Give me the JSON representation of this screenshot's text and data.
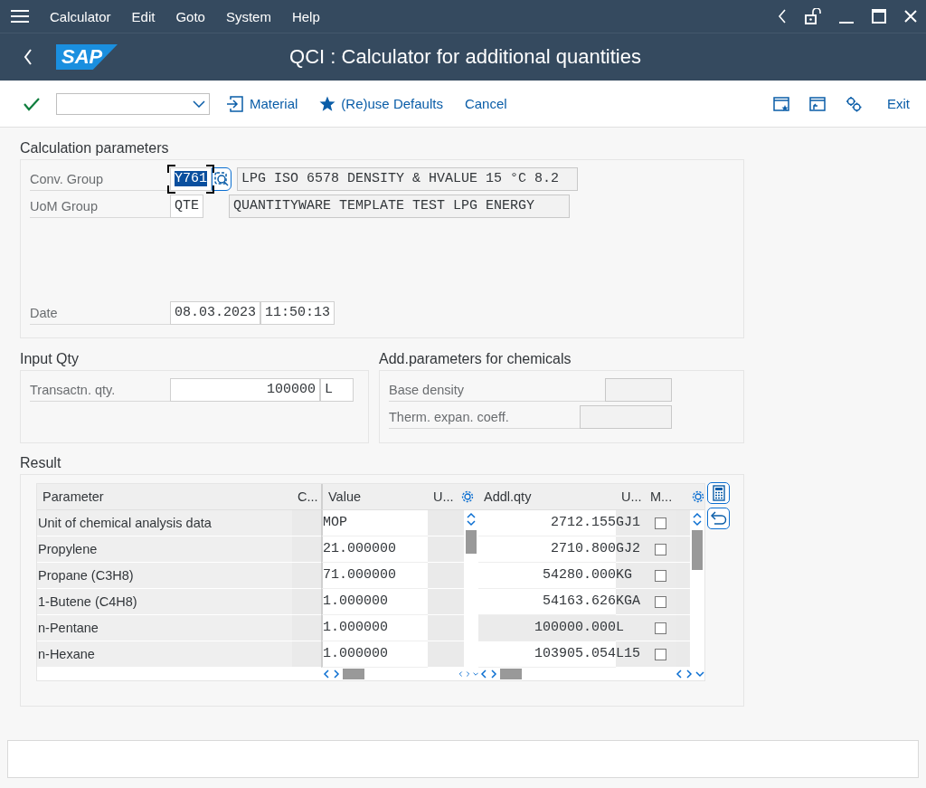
{
  "menu_bar": {
    "items": [
      "Calculator",
      "Edit",
      "Goto",
      "System",
      "Help"
    ]
  },
  "title_bar": {
    "logo": "SAP",
    "title": "QCI : Calculator for additional quantities"
  },
  "toolbar": {
    "buttons": [
      {
        "label": "Material",
        "kind": "import"
      },
      {
        "label": "(Re)use Defaults",
        "kind": "star"
      },
      {
        "label": "Cancel",
        "kind": "plain"
      }
    ],
    "exit": "Exit"
  },
  "calculation_parameters": {
    "title": "Calculation parameters",
    "fields": [
      {
        "label": "Conv. Group",
        "value": "Y761",
        "focused": true,
        "description": "LPG ISO 6578 DENSITY & HVALUE 15 °C 8.2"
      },
      {
        "label": "UoM Group",
        "value": "QTE",
        "focused": false,
        "description": "QUANTITYWARE TEMPLATE TEST LPG ENERGY"
      }
    ],
    "date": {
      "label": "Date",
      "date": "08.03.2023",
      "time": "11:50:13"
    }
  },
  "input_qty": {
    "title": "Input Qty",
    "label": "Transactn. qty.",
    "quantity": "100000",
    "unit": "L"
  },
  "chemical_parameters": {
    "title": "Add.parameters for chemicals",
    "fields": [
      {
        "label": "Base density"
      },
      {
        "label": "Therm. expan. coeff."
      }
    ]
  },
  "result": {
    "title": "Result",
    "parameter_table": {
      "columns": [
        "Parameter",
        "C...",
        "Value",
        "U..."
      ],
      "rows": [
        {
          "parameter": "Unit of chemical analysis data",
          "value": "MOP"
        },
        {
          "parameter": "Propylene",
          "value": "21.000000"
        },
        {
          "parameter": "Propane (C3H8)",
          "value": "71.000000"
        },
        {
          "parameter": "1-Butene (C4H8)",
          "value": "1.000000"
        },
        {
          "parameter": "n-Pentane",
          "value": "1.000000"
        },
        {
          "parameter": "n-Hexane",
          "value": "1.000000"
        }
      ]
    },
    "quantity_table": {
      "columns": [
        "Addl.qty",
        "U...",
        "M..."
      ],
      "rows": [
        {
          "quantity": "2712.155",
          "unit": "GJ1",
          "checked": false,
          "highlighted": false
        },
        {
          "quantity": "2710.800",
          "unit": "GJ2",
          "checked": false,
          "highlighted": false
        },
        {
          "quantity": "54280.000",
          "unit": "KG",
          "checked": false,
          "highlighted": false
        },
        {
          "quantity": "54163.626",
          "unit": "KGA",
          "checked": false,
          "highlighted": false
        },
        {
          "quantity": "100000.000",
          "unit": "L",
          "checked": false,
          "highlighted": true
        },
        {
          "quantity": "103905.054",
          "unit": "L15",
          "checked": false,
          "highlighted": false
        }
      ]
    }
  }
}
